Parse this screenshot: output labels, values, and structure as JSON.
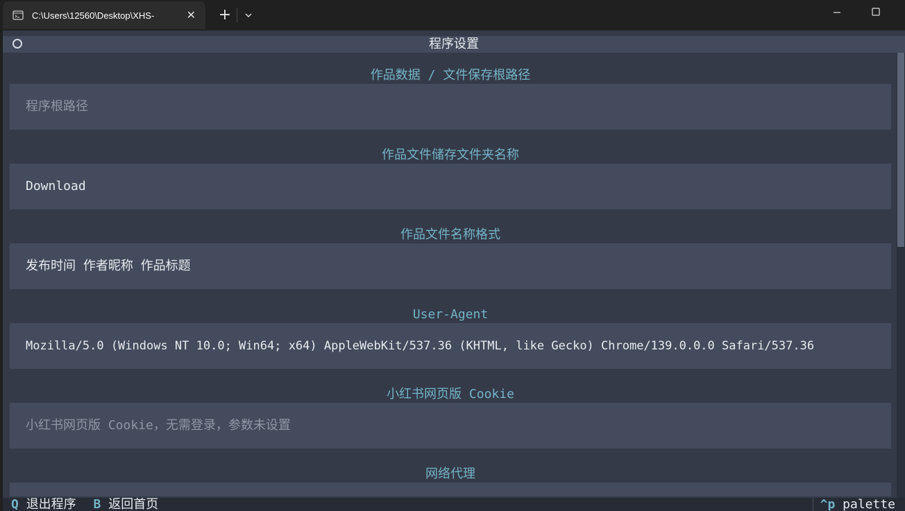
{
  "window": {
    "tab_title": "C:\\Users\\12560\\Desktop\\XHS-",
    "close_glyph": "✕",
    "new_tab_glyph": "+"
  },
  "header": {
    "title": "程序设置"
  },
  "fields": [
    {
      "label": "作品数据 / 文件保存根路径",
      "value": "",
      "placeholder": "程序根路径"
    },
    {
      "label": "作品文件储存文件夹名称",
      "value": "Download",
      "placeholder": ""
    },
    {
      "label": "作品文件名称格式",
      "value": "发布时间 作者昵称 作品标题",
      "placeholder": ""
    },
    {
      "label": "User-Agent",
      "value": "Mozilla/5.0 (Windows NT 10.0; Win64; x64) AppleWebKit/537.36 (KHTML, like Gecko) Chrome/139.0.0.0 Safari/537.36",
      "placeholder": ""
    },
    {
      "label": "小红书网页版 Cookie",
      "value": "",
      "placeholder": "小红书网页版 Cookie，无需登录，参数未设置"
    },
    {
      "label": "网络代理",
      "value": "",
      "placeholder": ""
    }
  ],
  "footer": {
    "quit_key": "Q",
    "quit_label": "退出程序",
    "back_key": "B",
    "back_label": "返回首页",
    "palette_key": "^p",
    "palette_label": "palette"
  },
  "colors": {
    "background": "#343a48",
    "input_background": "#434b5c",
    "accent": "#74b4c8",
    "text": "#e8ebf0",
    "placeholder": "#8f97a6"
  }
}
